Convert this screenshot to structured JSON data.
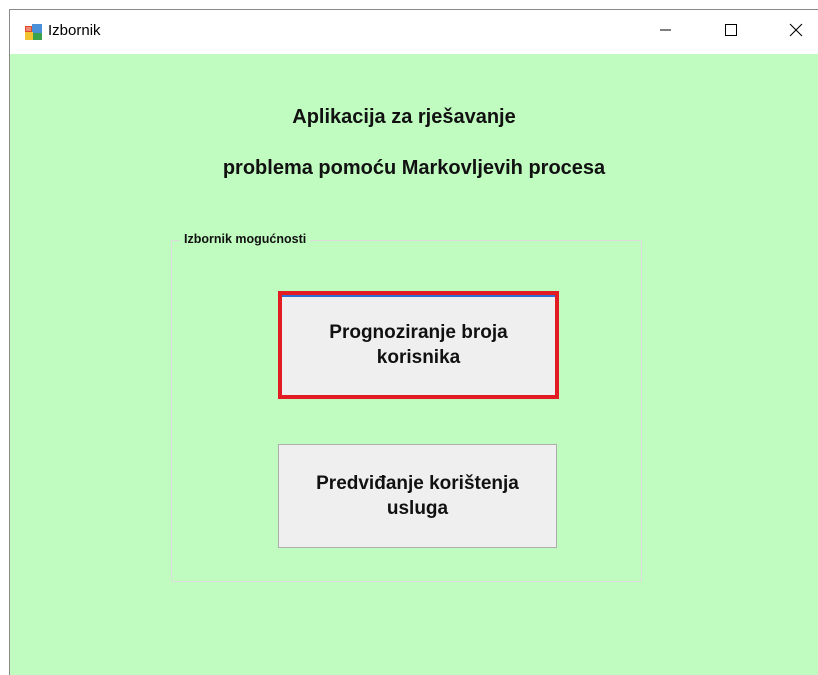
{
  "window": {
    "title": "Izbornik",
    "icon": "winforms-app-icon",
    "controls": {
      "minimize_icon": "minimize-icon",
      "maximize_icon": "maximize-icon",
      "close_icon": "close-icon"
    }
  },
  "main": {
    "heading_line1": "Aplikacija za rješavanje",
    "heading_line2": "problema pomoću Markovljevih procesa",
    "group": {
      "legend": "Izbornik mogućnosti",
      "buttons": [
        {
          "label": "Prognoziranje broja korisnika",
          "highlighted": true
        },
        {
          "label": "Predviđanje korištenja usluga",
          "highlighted": false
        }
      ]
    }
  },
  "colors": {
    "client_background": "#c0fcc0",
    "button_background": "#efefef",
    "highlight_border": "#e31b23"
  }
}
